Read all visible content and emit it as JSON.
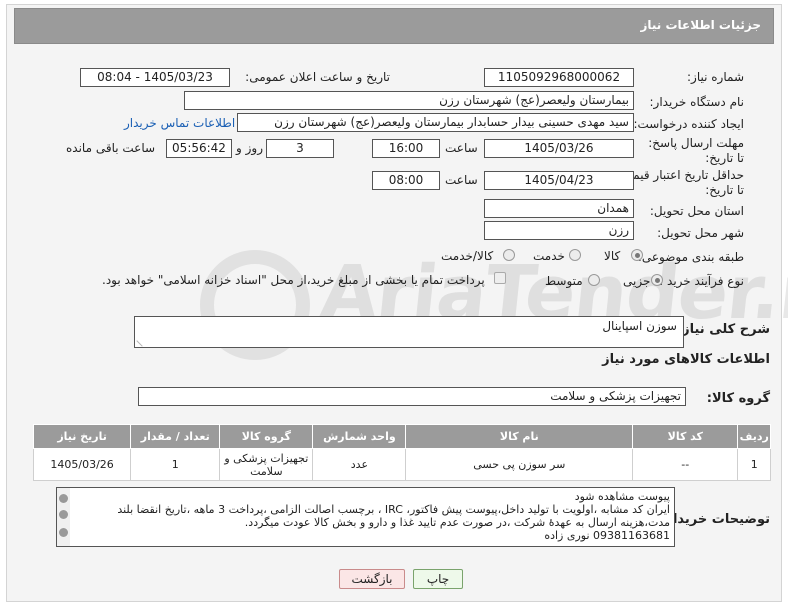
{
  "header": {
    "title": "جزئیات اطلاعات نیاز"
  },
  "form": {
    "need_number_label": "شماره نیاز:",
    "need_number": "1105092968000062",
    "announce_label": "تاریخ و ساعت اعلان عمومی:",
    "announce_value": "1405/03/23 - 08:04",
    "buyer_org_label": "نام دستگاه خریدار:",
    "buyer_org": "بیمارستان ولیعصر(عج) شهرستان رزن",
    "requester_label": "ایجاد کننده درخواست:",
    "requester": "سید مهدی حسینی بیدار حسابدار بیمارستان ولیعصر(عج) شهرستان رزن",
    "buyer_contact_link": "اطلاعات تماس خریدار",
    "deadline_label": "مهلت ارسال پاسخ: تا تاریخ:",
    "deadline_date": "1405/03/26",
    "time_label": "ساعت",
    "deadline_time": "16:00",
    "days_count": "3",
    "days_and_label": "روز و",
    "remaining_time": "05:56:42",
    "remaining_label": "ساعت باقی مانده",
    "price_validity_label": "حداقل تاریخ اعتبار قیمت: تا تاریخ:",
    "price_validity_date": "1405/04/23",
    "price_validity_time": "08:00",
    "province_label": "استان محل تحویل:",
    "province": "همدان",
    "city_label": "شهر محل تحویل:",
    "city": "رزن",
    "category_label": "طبقه بندی موضوعی:",
    "category_options": [
      "کالا",
      "خدمت",
      "کالا/خدمت"
    ],
    "process_label": "نوع فرآیند خرید :",
    "process_options": [
      "جزیی",
      "متوسط"
    ],
    "payment_note": "پرداخت تمام یا بخشی از مبلغ خرید،از محل \"اسناد خزانه اسلامی\" خواهد بود."
  },
  "summary": {
    "label": "شرح کلی نیاز:",
    "value": "سوزن اسپاینال"
  },
  "goods": {
    "section_title": "اطلاعات کالاهای مورد نیاز",
    "group_label": "گروه کالا:",
    "group_value": "تجهیزات پزشکی و سلامت",
    "columns": [
      "ردیف",
      "کد کالا",
      "نام کالا",
      "واحد شمارش",
      "گروه کالا",
      "تعداد / مقدار",
      "تاریخ نیاز"
    ],
    "rows": [
      [
        "1",
        "--",
        "سر سوزن پی حسی",
        "عدد",
        "تجهیزات پزشکی و سلامت",
        "1",
        "1405/03/26"
      ]
    ]
  },
  "buyer_notes": {
    "label": "توضیحات خریدار:",
    "lines": [
      "پیوست مشاهده شود",
      "ایران کد مشابه ،اولویت با تولید داخل،پیوست پیش فاکتور، IRC ، برچسب اصالت الزامی ،پرداخت 3 ماهه ،تاریخ انقضا بلند",
      "مدت،هزینه ارسال به عهدهٔ شرکت ،در صورت عدم تایید غذا و دارو و بخش کالا عودت میگردد.",
      "09381163681 نوری زاده"
    ]
  },
  "buttons": {
    "print": "چاپ",
    "back": "بازگشت"
  },
  "watermark": "AriaTender.neT"
}
